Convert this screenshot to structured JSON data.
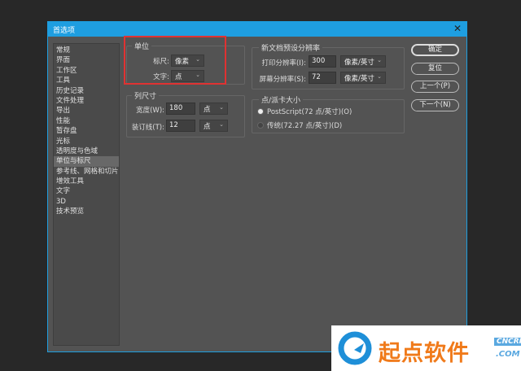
{
  "window": {
    "title": "首选项",
    "close_icon": "close-icon"
  },
  "sidebar": {
    "items": [
      "常规",
      "界面",
      "工作区",
      "工具",
      "历史记录",
      "文件处理",
      "导出",
      "性能",
      "暂存盘",
      "光标",
      "透明度与色域",
      "单位与标尺",
      "参考线、网格和切片",
      "增效工具",
      "文字",
      "3D",
      "技术预览"
    ],
    "selected": "单位与标尺"
  },
  "units": {
    "title": "单位",
    "ruler_label": "标尺:",
    "ruler_value": "像素",
    "type_label": "文字:",
    "type_value": "点"
  },
  "column": {
    "title": "列尺寸",
    "width_label": "宽度(W):",
    "width_value": "180",
    "width_unit": "点",
    "gutter_label": "装订线(T):",
    "gutter_value": "12",
    "gutter_unit": "点"
  },
  "resolution": {
    "title": "新文档预设分辨率",
    "print_label": "打印分辨率(I):",
    "print_value": "300",
    "print_unit": "像素/英寸",
    "screen_label": "屏幕分辨率(S):",
    "screen_value": "72",
    "screen_unit": "像素/英寸"
  },
  "point_size": {
    "title": "点/派卡大小",
    "postscript": "PostScript(72 点/英寸)(O)",
    "traditional": "传统(72.27 点/英寸)(D)",
    "selected": "postscript"
  },
  "buttons": {
    "ok": "确定",
    "reset": "复位",
    "prev": "上一个(P)",
    "next": "下一个(N)"
  },
  "watermark": {
    "text": "起点软件",
    "badge_top": "CNCRK",
    "badge_bottom": ".COM"
  },
  "colors": {
    "accent": "#1e9ee0",
    "highlight": "#e03232",
    "dialog_bg": "#535353",
    "watermark_orange": "#f07a1a"
  }
}
